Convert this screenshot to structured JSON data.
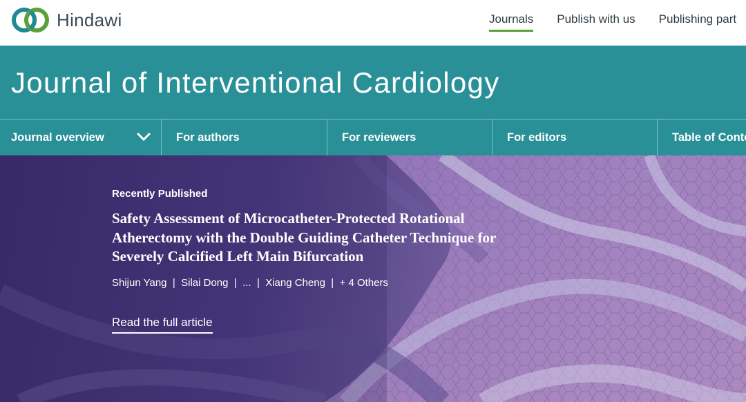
{
  "brand": {
    "name": "Hindawi",
    "logo_icon": "interlocking-rings-logo"
  },
  "top_nav": [
    {
      "label": "Journals",
      "active": true
    },
    {
      "label": "Publish with us",
      "active": false
    },
    {
      "label": "Publishing part",
      "active": false
    }
  ],
  "journal": {
    "title": "Journal of Interventional Cardiology"
  },
  "sub_nav": [
    {
      "label": "Journal overview",
      "icon": "chevron-down-icon"
    },
    {
      "label": "For authors"
    },
    {
      "label": "For reviewers"
    },
    {
      "label": "For editors"
    },
    {
      "label": "Table of Conte"
    }
  ],
  "hero": {
    "kicker": "Recently Published",
    "headline": "Safety Assessment of Microcatheter-Protected Rotational Atherectomy with the Double Guiding Catheter Technique for Severely Calcified Left Main Bifurcation",
    "authors": [
      "Shijun Yang",
      "Silai Dong",
      "...",
      "Xiang Cheng",
      "+ 4 Others"
    ],
    "separator": "|",
    "cta": "Read the full article"
  },
  "colors": {
    "teal": "#2a9098",
    "accent_green": "#5aa03b",
    "hero_purple": "#4a3a80"
  }
}
